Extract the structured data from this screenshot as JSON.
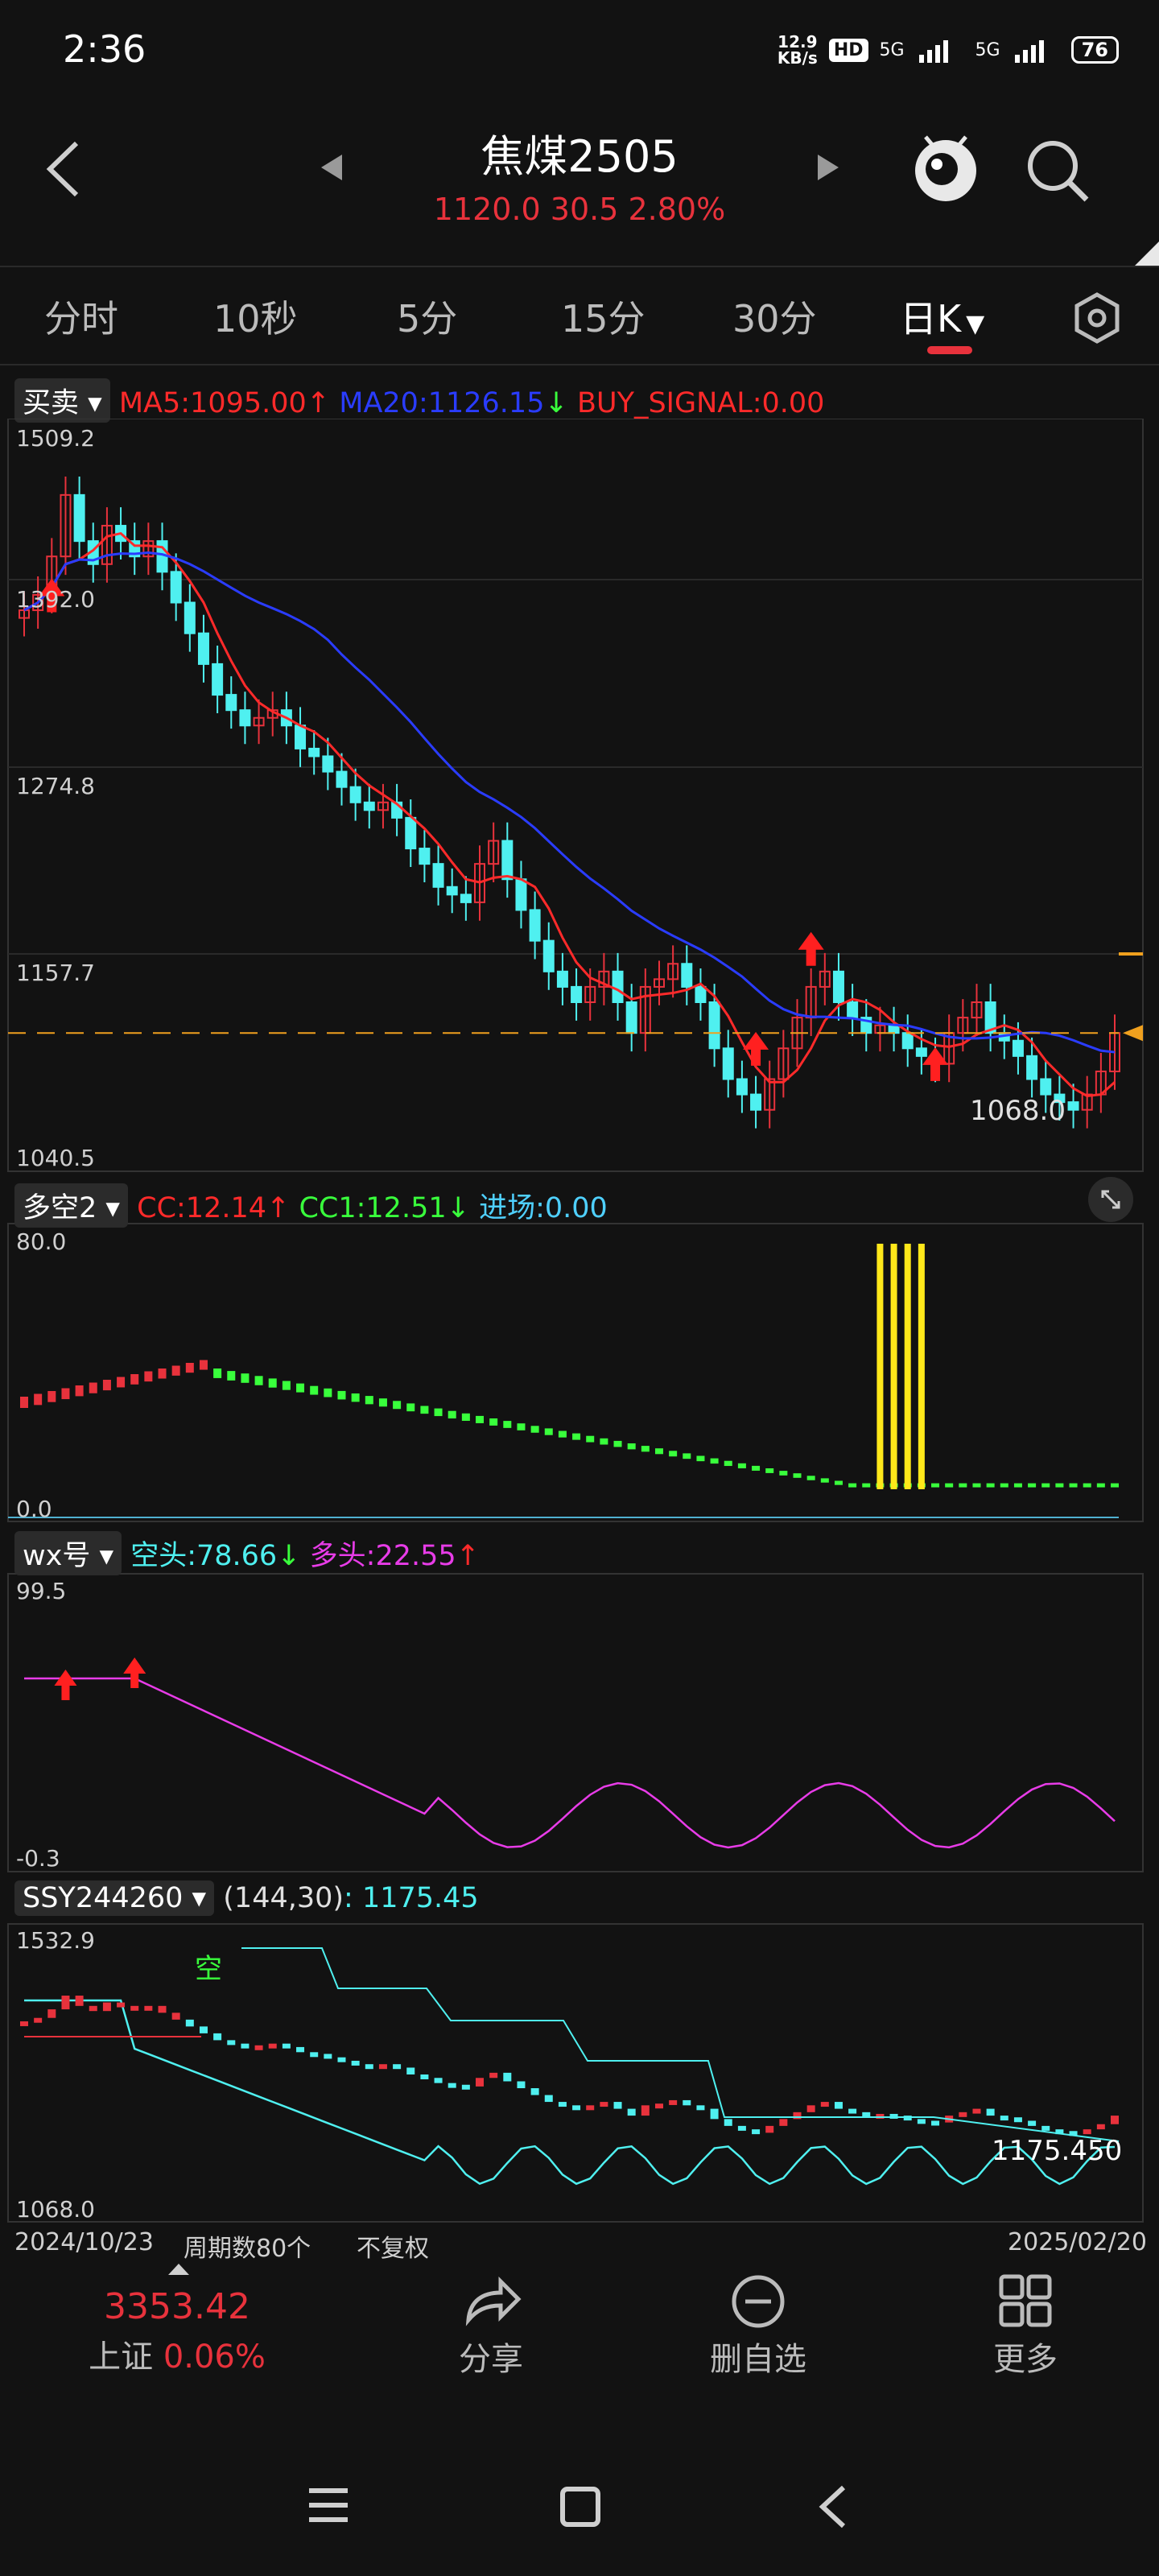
{
  "status": {
    "time": "2:36",
    "net_speed": "12.9",
    "net_unit": "KB/s",
    "hd": "HD",
    "sig1": "5G",
    "sig2": "5G",
    "battery": "76"
  },
  "header": {
    "title": "焦煤2505",
    "quote": "1120.0 30.5 2.80%"
  },
  "tabs": [
    {
      "label": "分时"
    },
    {
      "label": "10秒"
    },
    {
      "label": "5分"
    },
    {
      "label": "15分"
    },
    {
      "label": "30分"
    },
    {
      "label": "日K"
    }
  ],
  "panel1": {
    "dropdown": "买卖",
    "ma5": "MA5:1095.00",
    "ma20": "MA20:1126.15",
    "buy": "BUY_SIGNAL:0.00",
    "y_top": "1509.2",
    "y2": "1392.0",
    "y3": "1274.8",
    "y4": "1157.7",
    "y_bot": "1040.5",
    "low_label": "1068.0"
  },
  "panel2": {
    "dropdown": "多空2",
    "cc": "CC:12.14",
    "cc1": "CC1:12.51",
    "jc": "进场:0.00",
    "y_top": "80.0",
    "y_bot": "0.0"
  },
  "panel3": {
    "dropdown": "wx号",
    "kt": "空头:78.66",
    "dt": "多头:22.55",
    "y_top": "99.5",
    "y_bot": "-0.3"
  },
  "panel4": {
    "dropdown": "SSY244260",
    "params": "(144,30)",
    "value": ": 1175.45",
    "y_top": "1532.9",
    "y_bot": "1068.0",
    "kong": "空",
    "last": "1175.450"
  },
  "footer_axis": {
    "start": "2024/10/23",
    "period": "周期数80个",
    "adjust": "不复权",
    "end": "2025/02/20"
  },
  "bottom_nav": {
    "index_value": "3353.42",
    "index_name": "上证",
    "index_change": "0.06%",
    "share": "分享",
    "remove": "删自选",
    "more": "更多"
  },
  "colors": {
    "up": "#e8323c",
    "down": "#4ff0f0",
    "ma5": "#ff2a2a",
    "ma20": "#2a3cff",
    "signal": "#ffe81a",
    "bull": "#39ff3c",
    "magenta": "#e83ce8",
    "gold": "#f0a01e"
  },
  "chart_data": {
    "type": "candlestick",
    "x_range": [
      "2024/10/23",
      "2025/02/20"
    ],
    "count": 80,
    "ylim": [
      1040.5,
      1509.2
    ],
    "last_close": 1120.0,
    "close_series": [
      1395,
      1405,
      1430,
      1470,
      1440,
      1425,
      1450,
      1440,
      1430,
      1440,
      1420,
      1400,
      1380,
      1360,
      1340,
      1330,
      1320,
      1325,
      1330,
      1320,
      1305,
      1300,
      1290,
      1280,
      1270,
      1265,
      1270,
      1260,
      1240,
      1230,
      1215,
      1210,
      1205,
      1230,
      1245,
      1220,
      1200,
      1180,
      1160,
      1150,
      1140,
      1150,
      1160,
      1140,
      1120,
      1150,
      1155,
      1165,
      1150,
      1140,
      1110,
      1090,
      1080,
      1070,
      1090,
      1110,
      1130,
      1150,
      1160,
      1140,
      1130,
      1120,
      1125,
      1120,
      1110,
      1105,
      1100,
      1120,
      1130,
      1140,
      1120,
      1115,
      1105,
      1090,
      1080,
      1075,
      1070,
      1080,
      1095,
      1120
    ]
  }
}
